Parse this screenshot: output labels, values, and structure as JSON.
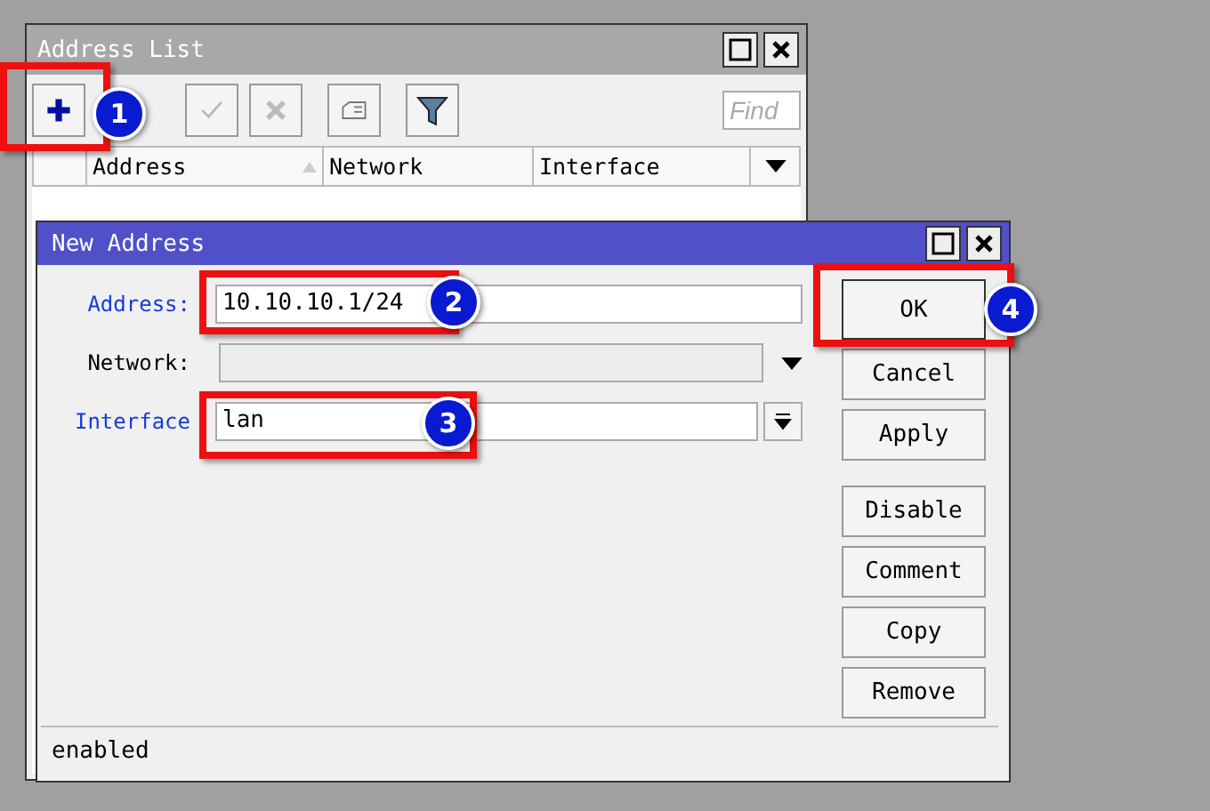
{
  "address_list": {
    "title": "Address List",
    "toolbar": [
      {
        "kind": "add"
      },
      {
        "kind": "enable"
      },
      {
        "kind": "disable"
      },
      {
        "kind": "comment"
      },
      {
        "kind": "filter"
      }
    ],
    "find": {
      "placeholder": "Find"
    },
    "columns": [
      "Address",
      "Network",
      "Interface"
    ]
  },
  "new_address": {
    "title": "New Address",
    "fields": [
      {
        "label": "Address:",
        "value": "10.10.10.1/24",
        "modified": true,
        "kind": "text"
      },
      {
        "label": "Network:",
        "modified": false,
        "kind": "combo"
      },
      {
        "label": "Interface",
        "value": "lan",
        "modified": true,
        "kind": "select"
      }
    ],
    "button_groups": [
      [
        {
          "label": "OK",
          "default": true
        },
        {
          "label": "Cancel",
          "default": false
        },
        {
          "label": "Apply",
          "default": false
        }
      ],
      [
        {
          "label": "Disable",
          "default": false
        },
        {
          "label": "Comment",
          "default": false
        },
        {
          "label": "Copy",
          "default": false
        },
        {
          "label": "Remove",
          "default": false
        }
      ]
    ],
    "status": "enabled"
  },
  "callouts": [
    "1",
    "2",
    "3",
    "4"
  ]
}
